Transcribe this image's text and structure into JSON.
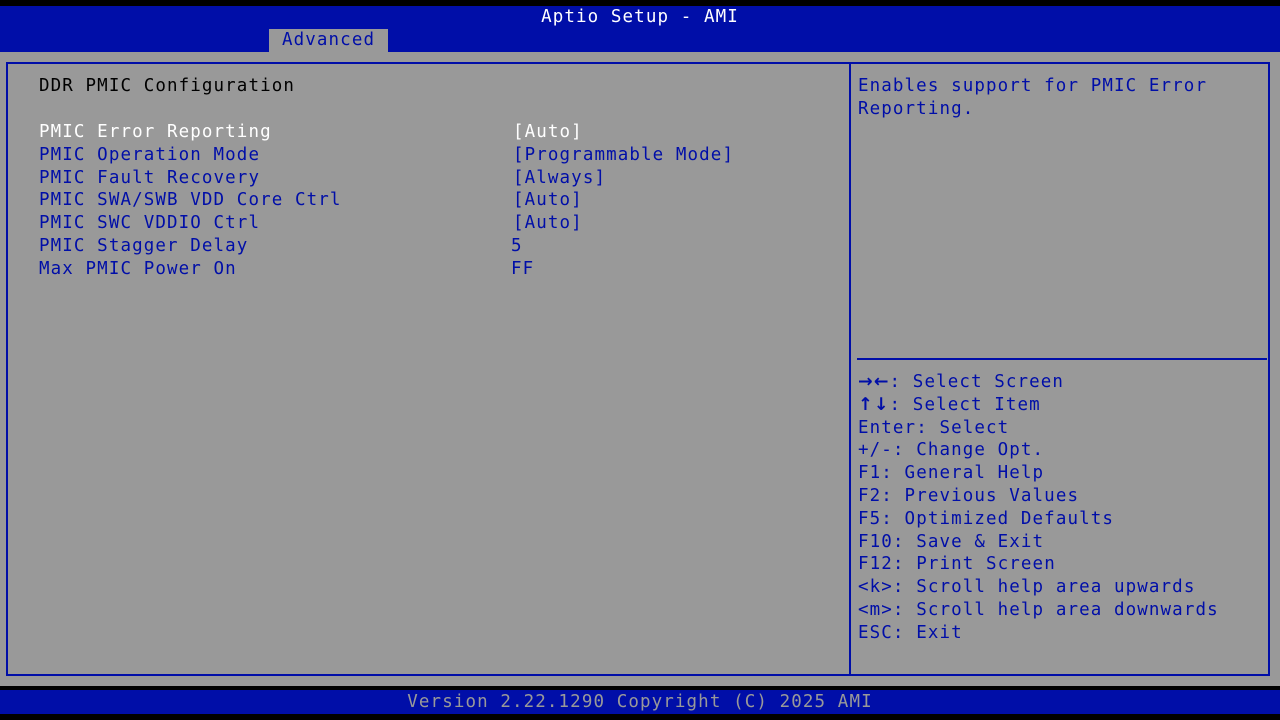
{
  "header": {
    "title": "Aptio Setup - AMI",
    "active_tab": "Advanced"
  },
  "page": {
    "section_title": "DDR PMIC Configuration",
    "settings": [
      {
        "label": "PMIC Error Reporting",
        "value": "[Auto]"
      },
      {
        "label": "PMIC Operation Mode",
        "value": "[Programmable Mode]"
      },
      {
        "label": "PMIC Fault Recovery",
        "value": "[Always]"
      },
      {
        "label": "PMIC SWA/SWB VDD Core Ctrl",
        "value": "[Auto]"
      },
      {
        "label": "PMIC SWC VDDIO Ctrl",
        "value": "[Auto]"
      },
      {
        "label": "PMIC Stagger Delay",
        "value": "5"
      },
      {
        "label": "Max PMIC Power On",
        "value": "FF"
      }
    ],
    "selected_index": 0
  },
  "help": {
    "text": "Enables support for PMIC Error Reporting."
  },
  "keys": [
    {
      "key": "→←",
      "desc": ": Select Screen"
    },
    {
      "key": "↑↓",
      "desc": ": Select Item"
    },
    {
      "key": "Enter",
      "desc": ": Select"
    },
    {
      "key": "+/-",
      "desc": ": Change Opt."
    },
    {
      "key": "F1",
      "desc": ": General Help"
    },
    {
      "key": "F2",
      "desc": ": Previous Values"
    },
    {
      "key": "F5",
      "desc": ": Optimized Defaults"
    },
    {
      "key": "F10",
      "desc": ": Save & Exit"
    },
    {
      "key": "F12",
      "desc": ": Print Screen"
    },
    {
      "key": "<k>",
      "desc": ": Scroll help area upwards"
    },
    {
      "key": "<m>",
      "desc": ": Scroll help area downwards"
    },
    {
      "key": "ESC",
      "desc": ": Exit"
    }
  ],
  "footer": {
    "version": "Version 2.22.1290 Copyright (C) 2025 AMI"
  },
  "colors": {
    "bios_blue": "#000ea8",
    "panel_gray": "#999999",
    "selected_text": "#ffffff",
    "section_text": "#000000"
  }
}
